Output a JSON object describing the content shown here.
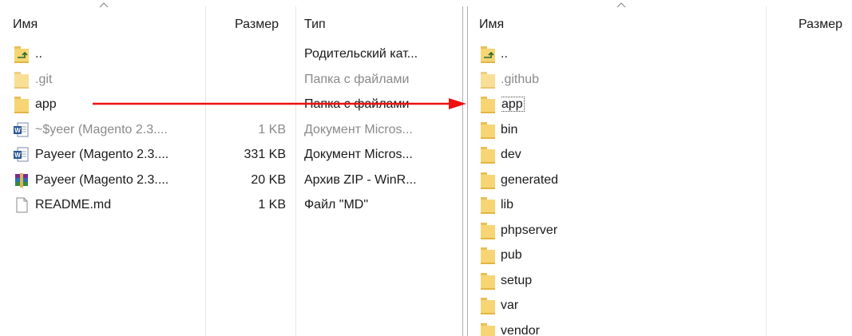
{
  "left": {
    "headers": {
      "name": "Имя",
      "size": "Размер",
      "type": "Тип"
    },
    "rows": [
      {
        "name": "..",
        "size": "",
        "type": "Родительский кат...",
        "icon": "parent-folder-icon",
        "muted": false
      },
      {
        "name": ".git",
        "size": "",
        "type": "Папка с файлами",
        "icon": "folder-icon",
        "muted": true
      },
      {
        "name": "app",
        "size": "",
        "type": "Папка с файлами",
        "icon": "folder-icon",
        "muted": false
      },
      {
        "name": "~$yeer (Magento 2.3....",
        "size": "1 KB",
        "type": "Документ Micros...",
        "icon": "word-doc-icon",
        "muted": true
      },
      {
        "name": "Payeer (Magento 2.3....",
        "size": "331 KB",
        "type": "Документ Micros...",
        "icon": "word-doc-icon",
        "muted": false
      },
      {
        "name": "Payeer (Magento 2.3....",
        "size": "20 KB",
        "type": "Архив ZIP - WinR...",
        "icon": "winrar-archive-icon",
        "muted": false
      },
      {
        "name": "README.md",
        "size": "1 KB",
        "type": "Файл \"MD\"",
        "icon": "file-icon",
        "muted": false
      }
    ]
  },
  "right": {
    "headers": {
      "name": "Имя",
      "size": "Размер"
    },
    "rows": [
      {
        "name": "..",
        "icon": "parent-folder-icon",
        "muted": false
      },
      {
        "name": ".github",
        "icon": "folder-icon",
        "muted": true
      },
      {
        "name": "app",
        "icon": "folder-icon",
        "muted": false,
        "focused": true
      },
      {
        "name": "bin",
        "icon": "folder-icon",
        "muted": false
      },
      {
        "name": "dev",
        "icon": "folder-icon",
        "muted": false
      },
      {
        "name": "generated",
        "icon": "folder-icon",
        "muted": false
      },
      {
        "name": "lib",
        "icon": "folder-icon",
        "muted": false
      },
      {
        "name": "phpserver",
        "icon": "folder-icon",
        "muted": false
      },
      {
        "name": "pub",
        "icon": "folder-icon",
        "muted": false
      },
      {
        "name": "setup",
        "icon": "folder-icon",
        "muted": false
      },
      {
        "name": "var",
        "icon": "folder-icon",
        "muted": false
      },
      {
        "name": "vendor",
        "icon": "folder-icon",
        "muted": false
      }
    ]
  },
  "annotation": {
    "arrow_color": "#ee1111"
  },
  "colors": {
    "folder": "#f7d574",
    "muted_text": "#8a8a8a"
  }
}
